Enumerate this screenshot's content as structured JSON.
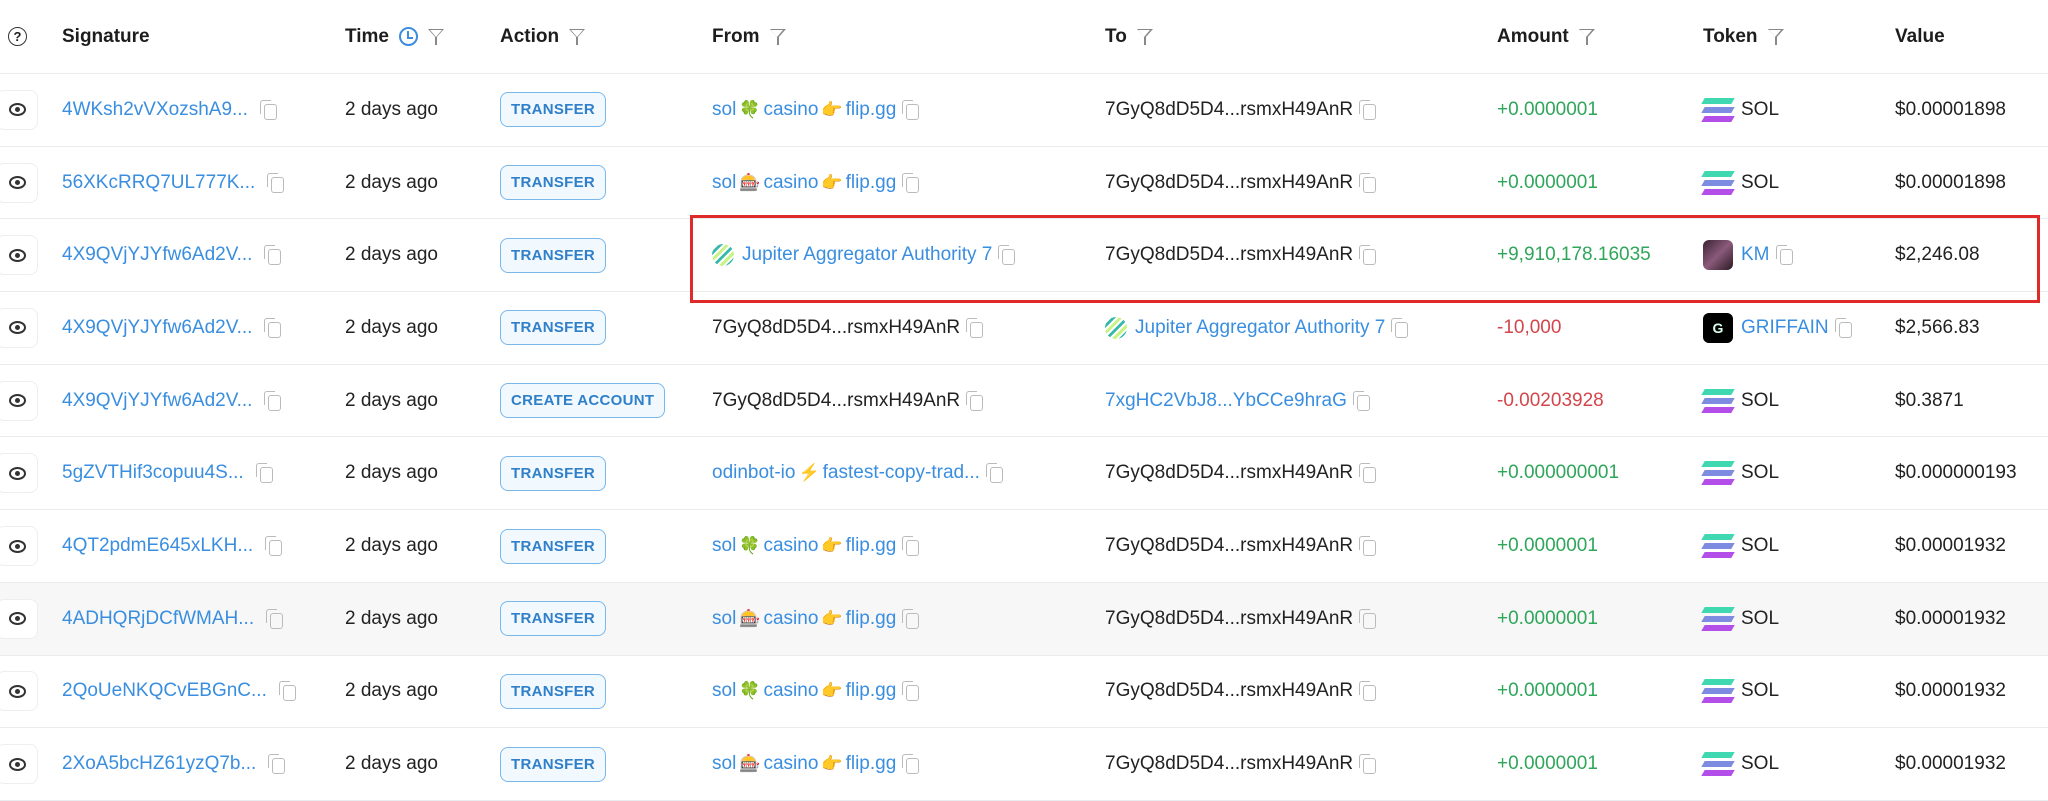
{
  "header": {
    "help_icon": "question-circle-icon",
    "signature": "Signature",
    "time": "Time",
    "action": "Action",
    "from": "From",
    "to": "To",
    "amount": "Amount",
    "token": "Token",
    "value": "Value"
  },
  "colors": {
    "link": "#3a8ee0",
    "positive": "#2fa65a",
    "negative": "#d2464b",
    "highlight_box": "#e02a2a"
  },
  "rows": [
    {
      "signature": "4WKsh2vVXozshA9...",
      "time": "2 days ago",
      "action": "TRANSFER",
      "from": {
        "parts": [
          "sol",
          "🍀",
          "casino",
          "👉",
          "flip.gg"
        ],
        "link": true,
        "copy": true
      },
      "to": {
        "text": "7GyQ8dD5D4...rsmxH49AnR",
        "link": false,
        "copy": true
      },
      "amount": "+0.0000001",
      "sign": "pos",
      "token": "SOL",
      "token_icon": "sol",
      "value": "$0.00001898"
    },
    {
      "signature": "56XKcRRQ7UL777K...",
      "time": "2 days ago",
      "action": "TRANSFER",
      "from": {
        "parts": [
          "sol",
          "🎰",
          "casino",
          "👉",
          "flip.gg"
        ],
        "link": true,
        "copy": true
      },
      "to": {
        "text": "7GyQ8dD5D4...rsmxH49AnR",
        "link": false,
        "copy": true
      },
      "amount": "+0.0000001",
      "sign": "pos",
      "token": "SOL",
      "token_icon": "sol",
      "value": "$0.00001898"
    },
    {
      "signature": "4X9QVjYJYfw6Ad2V...",
      "time": "2 days ago",
      "action": "TRANSFER",
      "from": {
        "text": "Jupiter Aggregator Authority 7",
        "icon": "jupiter",
        "link": true,
        "copy": true
      },
      "to": {
        "text": "7GyQ8dD5D4...rsmxH49AnR",
        "link": false,
        "copy": true
      },
      "amount": "+9,910,178.16035",
      "sign": "pos",
      "token": "KM",
      "token_icon": "km",
      "token_link": true,
      "value": "$2,246.08",
      "highlighted": true
    },
    {
      "signature": "4X9QVjYJYfw6Ad2V...",
      "time": "2 days ago",
      "action": "TRANSFER",
      "from": {
        "text": "7GyQ8dD5D4...rsmxH49AnR",
        "link": false,
        "copy": true
      },
      "to": {
        "text": "Jupiter Aggregator Authority 7",
        "icon": "jupiter",
        "link": true,
        "copy": true
      },
      "amount": "-10,000",
      "sign": "neg",
      "token": "GRIFFAIN",
      "token_icon": "griffain",
      "token_link": true,
      "value": "$2,566.83"
    },
    {
      "signature": "4X9QVjYJYfw6Ad2V...",
      "time": "2 days ago",
      "action": "CREATE ACCOUNT",
      "from": {
        "text": "7GyQ8dD5D4...rsmxH49AnR",
        "link": false,
        "copy": true
      },
      "to": {
        "text": "7xgHC2VbJ8...YbCCe9hraG",
        "link": true,
        "copy": true
      },
      "amount": "-0.00203928",
      "sign": "neg",
      "token": "SOL",
      "token_icon": "sol",
      "value": "$0.3871"
    },
    {
      "signature": "5gZVTHif3copuu4S...",
      "time": "2 days ago",
      "action": "TRANSFER",
      "from": {
        "parts": [
          "odinbot-io",
          "⚡",
          "fastest-copy-trad..."
        ],
        "link": true,
        "copy": true
      },
      "to": {
        "text": "7GyQ8dD5D4...rsmxH49AnR",
        "link": false,
        "copy": true
      },
      "amount": "+0.000000001",
      "sign": "pos",
      "token": "SOL",
      "token_icon": "sol",
      "value": "$0.000000193"
    },
    {
      "signature": "4QT2pdmE645xLKH...",
      "time": "2 days ago",
      "action": "TRANSFER",
      "from": {
        "parts": [
          "sol",
          "🍀",
          "casino",
          "👉",
          "flip.gg"
        ],
        "link": true,
        "copy": true
      },
      "to": {
        "text": "7GyQ8dD5D4...rsmxH49AnR",
        "link": false,
        "copy": true
      },
      "amount": "+0.0000001",
      "sign": "pos",
      "token": "SOL",
      "token_icon": "sol",
      "value": "$0.00001932"
    },
    {
      "signature": "4ADHQRjDCfWMAH...",
      "time": "2 days ago",
      "action": "TRANSFER",
      "from": {
        "parts": [
          "sol",
          "🎰",
          "casino",
          "👉",
          "flip.gg"
        ],
        "link": true,
        "copy": true
      },
      "to": {
        "text": "7GyQ8dD5D4...rsmxH49AnR",
        "link": false,
        "copy": true
      },
      "amount": "+0.0000001",
      "sign": "pos",
      "token": "SOL",
      "token_icon": "sol",
      "value": "$0.00001932",
      "hovered": true
    },
    {
      "signature": "2QoUeNKQCvEBGnC...",
      "time": "2 days ago",
      "action": "TRANSFER",
      "from": {
        "parts": [
          "sol",
          "🍀",
          "casino",
          "👉",
          "flip.gg"
        ],
        "link": true,
        "copy": true
      },
      "to": {
        "text": "7GyQ8dD5D4...rsmxH49AnR",
        "link": false,
        "copy": true
      },
      "amount": "+0.0000001",
      "sign": "pos",
      "token": "SOL",
      "token_icon": "sol",
      "value": "$0.00001932"
    },
    {
      "signature": "2XoA5bcHZ61yzQ7b...",
      "time": "2 days ago",
      "action": "TRANSFER",
      "from": {
        "parts": [
          "sol",
          "🎰",
          "casino",
          "👉",
          "flip.gg"
        ],
        "link": true,
        "copy": true
      },
      "to": {
        "text": "7GyQ8dD5D4...rsmxH49AnR",
        "link": false,
        "copy": true
      },
      "amount": "+0.0000001",
      "sign": "pos",
      "token": "SOL",
      "token_icon": "sol",
      "value": "$0.00001932"
    }
  ]
}
